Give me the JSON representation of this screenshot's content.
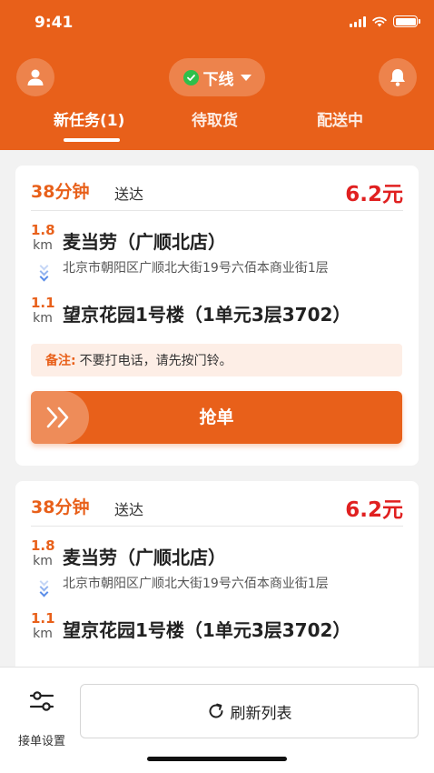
{
  "status_bar": {
    "time": "9:41"
  },
  "header": {
    "status_label": "下线",
    "tabs": [
      {
        "label": "新任务(1)",
        "active": true
      },
      {
        "label": "待取货",
        "active": false
      },
      {
        "label": "配送中",
        "active": false
      }
    ]
  },
  "orders": [
    {
      "eta": "38分钟",
      "eta_suffix": "送达",
      "price": "6.2元",
      "pickup_distance": "1.8",
      "pickup_unit": "km",
      "shop_name": "麦当劳（广顺北店）",
      "shop_address": "北京市朝阳区广顺北大街19号六佰本商业街1层",
      "dropoff_distance": "1.1",
      "dropoff_unit": "km",
      "dropoff_address": "望京花园1号楼（1单元3层3702）",
      "note_label": "备注:",
      "note_text": "不要打电话，请先按门铃。",
      "grab_label": "抢单"
    },
    {
      "eta": "38分钟",
      "eta_suffix": "送达",
      "price": "6.2元",
      "pickup_distance": "1.8",
      "pickup_unit": "km",
      "shop_name": "麦当劳（广顺北店）",
      "shop_address": "北京市朝阳区广顺北大街19号六佰本商业街1层",
      "dropoff_distance": "1.1",
      "dropoff_unit": "km",
      "dropoff_address": "望京花园1号楼（1单元3层3702）"
    }
  ],
  "bottom_bar": {
    "settings_label": "接单设置",
    "refresh_label": "刷新列表"
  },
  "colors": {
    "brand": "#e8601a",
    "price": "#e02020",
    "online_check": "#2fbf4a",
    "route_chevron": "#5b8de8"
  }
}
